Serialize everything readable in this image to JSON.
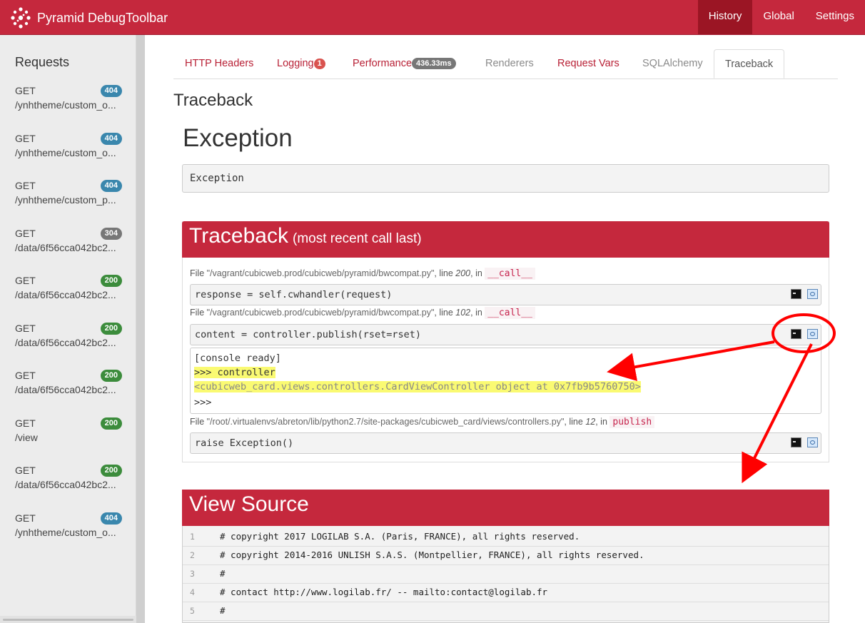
{
  "navbar": {
    "brand": "Pyramid DebugToolbar",
    "links": [
      "History",
      "Global",
      "Settings"
    ]
  },
  "sidebar": {
    "title": "Requests",
    "requests": [
      {
        "method": "GET",
        "status": "404",
        "path": "/ynhtheme/custom_o..."
      },
      {
        "method": "GET",
        "status": "404",
        "path": "/ynhtheme/custom_o..."
      },
      {
        "method": "GET",
        "status": "404",
        "path": "/ynhtheme/custom_p..."
      },
      {
        "method": "GET",
        "status": "304",
        "path": "/data/6f56cca042bc2..."
      },
      {
        "method": "GET",
        "status": "200",
        "path": "/data/6f56cca042bc2..."
      },
      {
        "method": "GET",
        "status": "200",
        "path": "/data/6f56cca042bc2..."
      },
      {
        "method": "GET",
        "status": "200",
        "path": "/data/6f56cca042bc2..."
      },
      {
        "method": "GET",
        "status": "200",
        "path": "/view"
      },
      {
        "method": "GET",
        "status": "200",
        "path": "/data/6f56cca042bc2..."
      },
      {
        "method": "GET",
        "status": "404",
        "path": "/ynhtheme/custom_o..."
      }
    ]
  },
  "tabs": {
    "http_headers": "HTTP Headers",
    "logging": "Logging",
    "logging_count": "1",
    "performance": "Performance",
    "performance_time": "436.33ms",
    "renderers": "Renderers",
    "request_vars": "Request Vars",
    "sqlalchemy": "SQLAlchemy",
    "traceback": "Traceback"
  },
  "main": {
    "section_title": "Traceback",
    "exception_title": "Exception",
    "exception_message": "Exception",
    "traceback_title": "Traceback",
    "traceback_subtitle": "(most recent call last)",
    "frames": [
      {
        "prefix": "File ",
        "file": "\"/vagrant/cubicweb.prod/cubicweb/pyramid/bwcompat.py\"",
        "line_prefix": ", line ",
        "line": "200",
        "in": ", in ",
        "func": "__call__",
        "code": "response = self.cwhandler(request)"
      },
      {
        "prefix": "File ",
        "file": "\"/vagrant/cubicweb.prod/cubicweb/pyramid/bwcompat.py\"",
        "line_prefix": ", line ",
        "line": "102",
        "in": ", in ",
        "func": "__call__",
        "code": "content = controller.publish(rset=rset)"
      },
      {
        "prefix": "File ",
        "file": "\"/root/.virtualenvs/abreton/lib/python2.7/site-packages/cubicweb_card/views/controllers.py\"",
        "line_prefix": ", line ",
        "line": "12",
        "in": ", in ",
        "func": "publish",
        "code": "raise Exception()"
      }
    ],
    "console": {
      "ready": "[console ready]",
      "input": ">>> controller",
      "output": "<cubicweb_card.views.controllers.CardViewController object at 0x7fb9b5760750>",
      "prompt": ">>>"
    },
    "view_source_title": "View Source",
    "source_lines": [
      {
        "n": "1",
        "code": "# copyright 2017 LOGILAB S.A. (Paris, FRANCE), all rights reserved."
      },
      {
        "n": "2",
        "code": "# copyright 2014-2016 UNLISH S.A.S. (Montpellier, FRANCE), all rights reserved."
      },
      {
        "n": "3",
        "code": "#"
      },
      {
        "n": "4",
        "code": "# contact http://www.logilab.fr/ -- mailto:contact@logilab.fr"
      },
      {
        "n": "5",
        "code": "#"
      }
    ]
  },
  "colors": {
    "brand": "#c5283d",
    "active_nav": "#9b1524",
    "annotation": "#ff0000",
    "highlight": "#fafa72"
  }
}
